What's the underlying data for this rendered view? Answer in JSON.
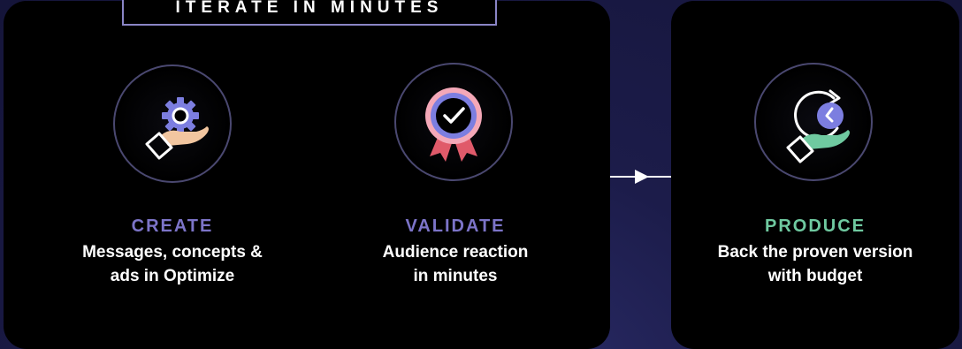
{
  "banner": {
    "label": "ITERATE IN MINUTES"
  },
  "steps": [
    {
      "title": "CREATE",
      "desc_line1": "Messages, concepts &",
      "desc_line2": "ads in Optimize",
      "icon": "hand-gear-icon"
    },
    {
      "title": "VALIDATE",
      "desc_line1": "Audience reaction",
      "desc_line2": "in minutes",
      "icon": "award-ribbon-check-icon"
    },
    {
      "title": "PRODUCE",
      "desc_line1": "Back the proven version",
      "desc_line2": "with budget",
      "icon": "hand-clock-icon"
    }
  ],
  "colors": {
    "accent_purple": "#7c74c8",
    "accent_green": "#6fc9a0",
    "background": "#1c1c4a",
    "panel": "#000000"
  }
}
